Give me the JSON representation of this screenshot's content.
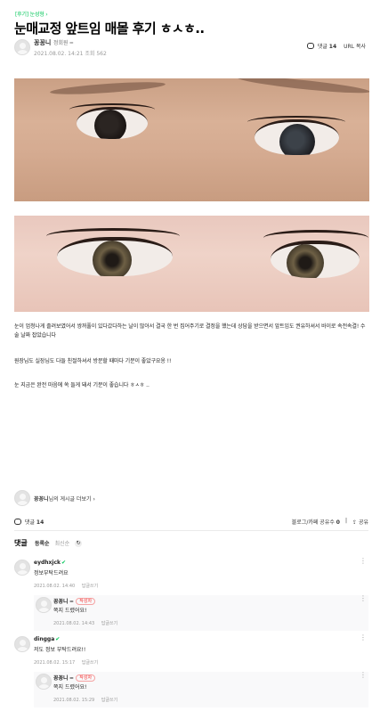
{
  "article": {
    "category": "[후기] 눈성형 ›",
    "title": "눈매교정 앞트임 매몰 후기 ㅎㅅㅎ..",
    "author": {
      "name": "꽁꽁니",
      "grade": "정회원 ━",
      "date": "2021.08.02. 14:21",
      "views": "조회 562"
    },
    "comment_label": "댓글",
    "comment_count": "14",
    "url_copy": "URL 복사",
    "paragraphs": [
      "눈이 엄청나게 졸려보였어서 쌍꺼풀이 있다갔다하는 날이 많아서 결국 한 번 집어주기로 결정을 했는데 상담을 받으면서 앞트임도 권유하셔서 바이로 속전속결! 수술 날짜 잡았습니다",
      "원장님도 실장님도 다들 친절하셔서 방문할 때마다 기분이 좋았구요옹 !!",
      "눈 지금은 완전 마음에 쏙 들게 돼서 기분이 좋습니다 ㅎㅅㅎ .."
    ]
  },
  "more_posts": {
    "name": "꽁꽁니",
    "suffix": "님의 게시글 더보기 ›"
  },
  "action_bar": {
    "comment_label": "댓글",
    "comment_count": "14",
    "blog_share": "블로그/카페 공유수",
    "blog_share_count": "0",
    "share": "공유"
  },
  "comments_section": {
    "heading": "댓글",
    "sort_active": "등록순",
    "sort_other": "최신순",
    "refresh_icon": "↻",
    "write_reply_label": "답글쓰기",
    "author_badge": "작성자",
    "items": [
      {
        "nick": "eydhxjck",
        "verified": "✔",
        "badge": "",
        "body": "정보부탁드려요",
        "date": "2021.08.02. 14:40",
        "reply": false
      },
      {
        "nick": "꽁꽁니 ━",
        "verified": "",
        "badge": "작성자",
        "body": "쪽지 드렸어요!",
        "date": "2021.08.02. 14:43",
        "reply": true
      },
      {
        "nick": "dingga",
        "verified": "✔",
        "badge": "",
        "body": "저도 정보 부탁드려요!!",
        "date": "2021.08.02. 15:17",
        "reply": false
      },
      {
        "nick": "꽁꽁니 ━",
        "verified": "",
        "badge": "작성자",
        "body": "쪽지 드렸어요!",
        "date": "2021.08.02. 15:29",
        "reply": true
      }
    ]
  },
  "colors": {
    "accent_green": "#03c75a",
    "badge_red": "#f53535",
    "reply_bg": "#f9f9fa"
  },
  "icons": [
    "comment-bubble-icon",
    "refresh-icon",
    "kebab-menu-icon",
    "share-icon",
    "avatar-icon",
    "verified-check-icon"
  ]
}
